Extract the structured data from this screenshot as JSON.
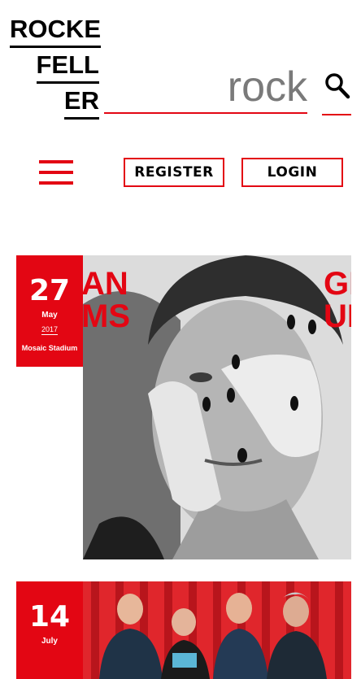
{
  "logo": {
    "line1": "ROCKE",
    "line2": "FELL",
    "line3": "ER"
  },
  "search": {
    "value": "rock",
    "icon": "search-icon"
  },
  "nav": {
    "menu_icon": "hamburger-menu-icon",
    "register_label": "REGISTER",
    "login_label": "LOGIN"
  },
  "colors": {
    "accent": "#e30613",
    "text": "#000000",
    "background": "#ffffff"
  },
  "events": [
    {
      "day": "27",
      "month": "May",
      "year": "2017",
      "venue": "Mosaic Stadium",
      "poster_text_left": "AN\nMS",
      "poster_text_right": "GI\nUI"
    },
    {
      "day": "14",
      "month": "July"
    }
  ]
}
